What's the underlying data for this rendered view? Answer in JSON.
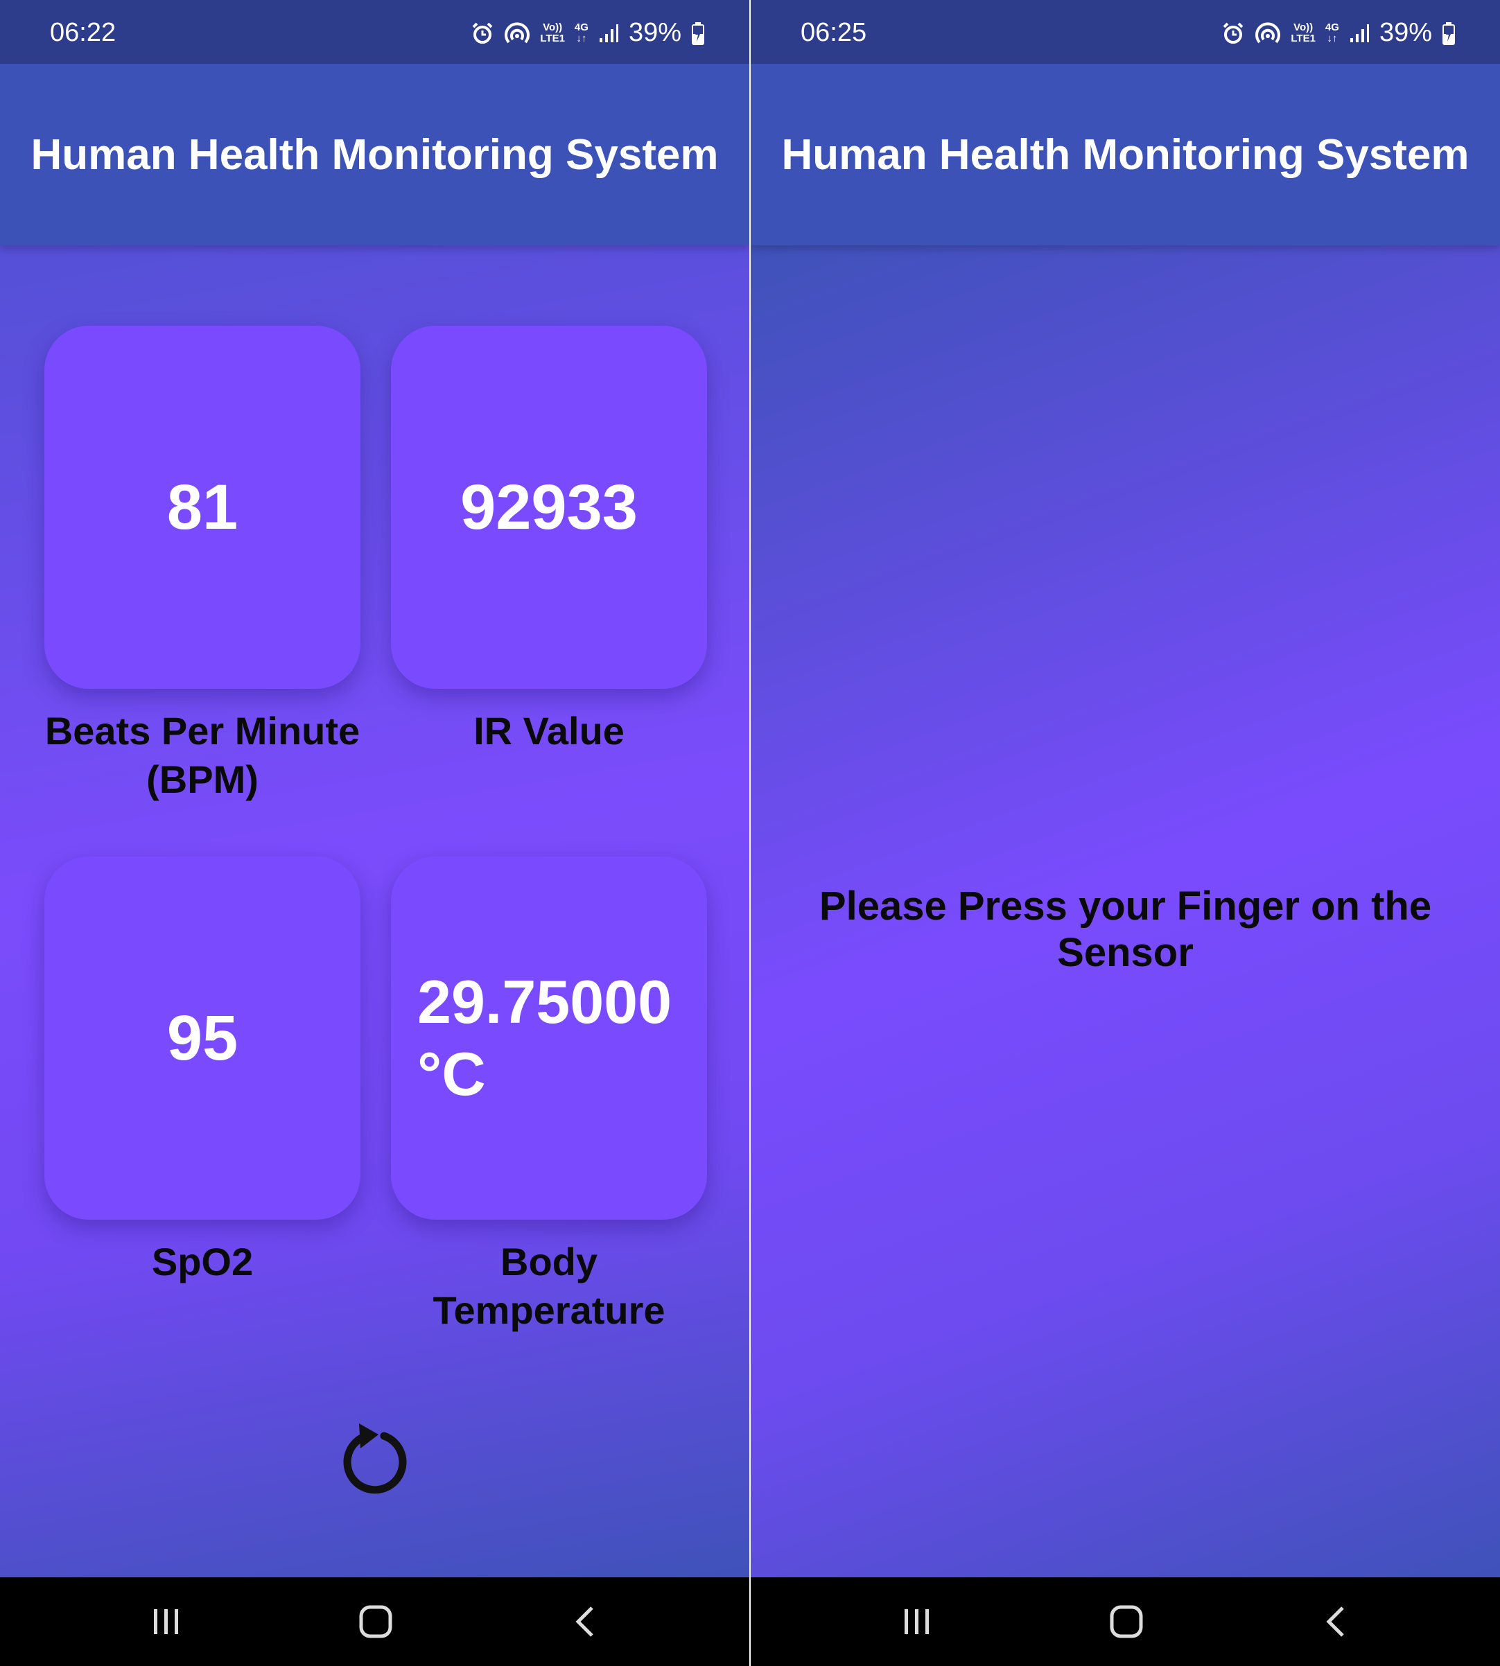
{
  "left": {
    "status": {
      "time": "06:22",
      "volte_top": "Vo))",
      "volte_bottom": "LTE1",
      "net_top": "4G",
      "net_bottom": "↓↑",
      "battery": "39%"
    },
    "app_title": "Human Health Monitoring System",
    "tiles": [
      {
        "value": "81",
        "label_line1": "Beats Per Minute",
        "label_line2": "(BPM)"
      },
      {
        "value": "92933",
        "label_line1": "IR Value",
        "label_line2": ""
      },
      {
        "value": "95",
        "label_line1": "SpO2",
        "label_line2": ""
      },
      {
        "value_line1": "29.75000",
        "value_line2": "°C",
        "label_line1": "Body",
        "label_line2": "Temperature"
      }
    ],
    "refresh_icon": "refresh-icon"
  },
  "right": {
    "status": {
      "time": "06:25",
      "volte_top": "Vo))",
      "volte_bottom": "LTE1",
      "net_top": "4G",
      "net_bottom": "↓↑",
      "battery": "39%"
    },
    "app_title": "Human Health Monitoring System",
    "message": "Please Press your Finger on the Sensor"
  },
  "nav": {
    "recents_icon": "recents-icon",
    "home_icon": "home-icon",
    "back_icon": "back-icon"
  },
  "colors": {
    "status_bar": "#2e3d8b",
    "app_bar": "#3d52b7",
    "tile": "#7a4bfe",
    "accent_purple": "#7b4cfb",
    "nav_bar": "#000000"
  }
}
